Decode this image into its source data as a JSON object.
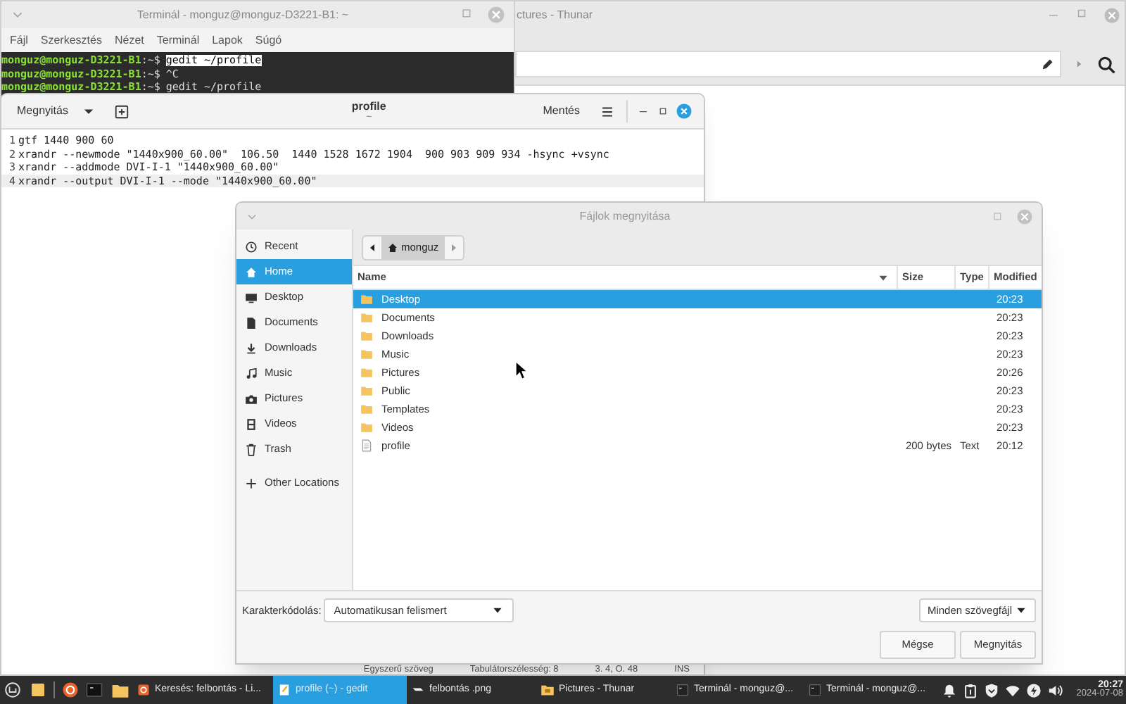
{
  "thunar": {
    "title": "ctures - Thunar"
  },
  "terminal": {
    "title": "Terminál - monguz@monguz-D3221-B1: ~",
    "menu": [
      "Fájl",
      "Szerkesztés",
      "Nézet",
      "Terminál",
      "Lapok",
      "Súgó"
    ],
    "lines": [
      {
        "prompt": "monguz@monguz-D3221-B1",
        "path": ":~$",
        "command": "gedit ~/profile",
        "selected": true
      },
      {
        "prompt": "monguz@monguz-D3221-B1",
        "path": ":~$",
        "command": "^C",
        "selected": false
      },
      {
        "prompt": "monguz@monguz-D3221-B1",
        "path": ":~$",
        "command": "gedit ~/profile",
        "selected": false
      }
    ]
  },
  "gedit": {
    "open_button": "Megnyitás",
    "title": "profile",
    "subtitle": "~",
    "save_button": "Mentés",
    "lines": [
      {
        "number": "1",
        "text": "gtf 1440 900 60",
        "current": false
      },
      {
        "number": "2",
        "text": "xrandr --newmode \"1440x900_60.00\"  106.50  1440 1528 1672 1904  900 903 909 934 -hsync +vsync",
        "current": false
      },
      {
        "number": "3",
        "text": "xrandr --addmode DVI-I-1 \"1440x900_60.00\"",
        "current": false
      },
      {
        "number": "4",
        "text": "xrandr --output DVI-I-1 --mode \"1440x900_60.00\"",
        "current": true
      }
    ],
    "status_bar": [
      "Egyszerű szöveg",
      "Tabulátorszélesség: 8",
      "3. 4, O. 48",
      "INS"
    ]
  },
  "dialog": {
    "title": "Fájlok megnyitása",
    "places": [
      {
        "label": "Recent",
        "selected": false
      },
      {
        "label": "Home",
        "selected": true
      },
      {
        "label": "Desktop",
        "selected": false
      },
      {
        "label": "Documents",
        "selected": false
      },
      {
        "label": "Downloads",
        "selected": false
      },
      {
        "label": "Music",
        "selected": false
      },
      {
        "label": "Pictures",
        "selected": false
      },
      {
        "label": "Videos",
        "selected": false
      },
      {
        "label": "Trash",
        "selected": false
      },
      {
        "label": "Other Locations",
        "selected": false
      }
    ],
    "path_button": "monguz",
    "columns": [
      "Name",
      "Size",
      "Type",
      "Modified"
    ],
    "rows": [
      {
        "kind": "folder",
        "name": "Desktop",
        "modified": "20:23",
        "selected": true
      },
      {
        "kind": "folder",
        "name": "Documents",
        "modified": "20:23",
        "selected": false
      },
      {
        "kind": "folder",
        "name": "Downloads",
        "modified": "20:23",
        "selected": false
      },
      {
        "kind": "folder",
        "name": "Music",
        "modified": "20:23",
        "selected": false
      },
      {
        "kind": "folder",
        "name": "Pictures",
        "modified": "20:26",
        "selected": false
      },
      {
        "kind": "folder",
        "name": "Public",
        "modified": "20:23",
        "selected": false
      },
      {
        "kind": "folder",
        "name": "Templates",
        "modified": "20:23",
        "selected": false
      },
      {
        "kind": "folder",
        "name": "Videos",
        "modified": "20:23",
        "selected": false
      },
      {
        "kind": "file",
        "name": "profile",
        "size": "200 bytes",
        "type": "Text",
        "modified": "20:12",
        "selected": false
      }
    ],
    "encoding_label": "Karakterkódolás:",
    "encoding_value": "Automatikusan felismert",
    "filter": "Minden szövegfájl",
    "buttons": [
      "Mégse",
      "Megnyitás"
    ]
  },
  "taskbar": {
    "windows": [
      {
        "label": "Keresés: felbontás - Li...",
        "selected": false
      },
      {
        "label": "profile (~) - gedit",
        "selected": true
      },
      {
        "label": "felbontás .png",
        "selected": false
      },
      {
        "label": "Pictures - Thunar",
        "selected": false
      },
      {
        "label": "Terminál - monguz@...",
        "selected": false
      },
      {
        "label": "Terminál - monguz@...",
        "selected": false
      }
    ],
    "time": "20:27",
    "date": "2024-07-08"
  }
}
